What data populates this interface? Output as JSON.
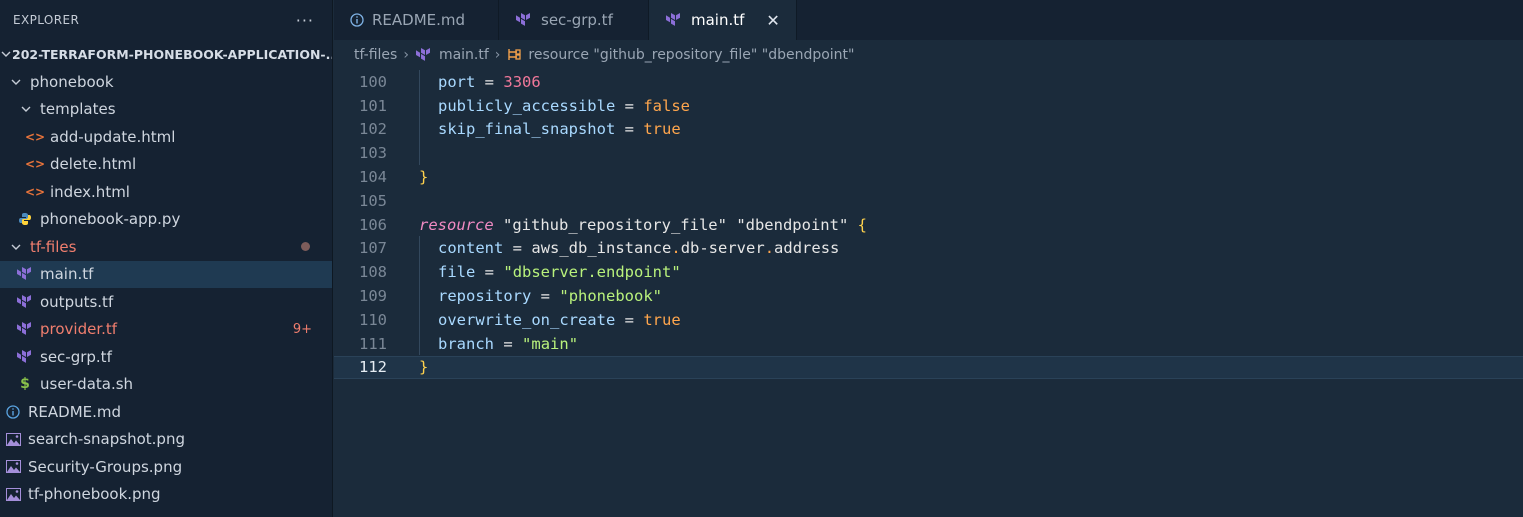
{
  "sidebar": {
    "title": "EXPLORER",
    "more": "···",
    "project": "202-TERRAFORM-PHONEBOOK-APPLICATION-...",
    "items": [
      {
        "label": "phonebook"
      },
      {
        "label": "templates"
      },
      {
        "label": "add-update.html"
      },
      {
        "label": "delete.html"
      },
      {
        "label": "index.html"
      },
      {
        "label": "phonebook-app.py"
      },
      {
        "label": "tf-files"
      },
      {
        "label": "main.tf"
      },
      {
        "label": "outputs.tf"
      },
      {
        "label": "provider.tf",
        "badge": "9+"
      },
      {
        "label": "sec-grp.tf"
      },
      {
        "label": "user-data.sh"
      },
      {
        "label": "README.md"
      },
      {
        "label": "search-snapshot.png"
      },
      {
        "label": "Security-Groups.png"
      },
      {
        "label": "tf-phonebook.png"
      }
    ]
  },
  "tabs": [
    {
      "label": "README.md"
    },
    {
      "label": "sec-grp.tf"
    },
    {
      "label": "main.tf",
      "close": "✕"
    }
  ],
  "breadcrumb": {
    "folder": "tf-files",
    "file": "main.tf",
    "symbol": "resource \"github_repository_file\" \"dbendpoint\""
  },
  "editor": {
    "lines": [
      {
        "n": "100"
      },
      {
        "n": "101"
      },
      {
        "n": "102"
      },
      {
        "n": "103"
      },
      {
        "n": "104"
      },
      {
        "n": "105"
      },
      {
        "n": "106"
      },
      {
        "n": "107"
      },
      {
        "n": "108"
      },
      {
        "n": "109"
      },
      {
        "n": "110"
      },
      {
        "n": "111"
      },
      {
        "n": "112"
      }
    ],
    "tokens": {
      "port": "port",
      "port_val": "3306",
      "pa": "publicly_accessible",
      "pa_val": "false",
      "sfs": "skip_final_snapshot",
      "sfs_val": "true",
      "close1": "}",
      "resource": "resource",
      "rtype": "\"github_repository_file\"",
      "rname": "\"dbendpoint\"",
      "open": "{",
      "content": "content",
      "c1": "aws_db_instance",
      "c2": "db-server",
      "c3": "address",
      "file": "file",
      "file_val": "\"dbserver.endpoint\"",
      "repo": "repository",
      "repo_val": "\"phonebook\"",
      "ooc": "overwrite_on_create",
      "ooc_val": "true",
      "branch": "branch",
      "branch_val": "\"main\"",
      "close2": "}",
      "eq": "=",
      "dot": "."
    }
  },
  "colors": {
    "sidebar_bg": "#152232",
    "editor_bg": "#1b2b3b",
    "terraform_purple": "#8c6fd8",
    "modified_red": "#f07e6e"
  }
}
